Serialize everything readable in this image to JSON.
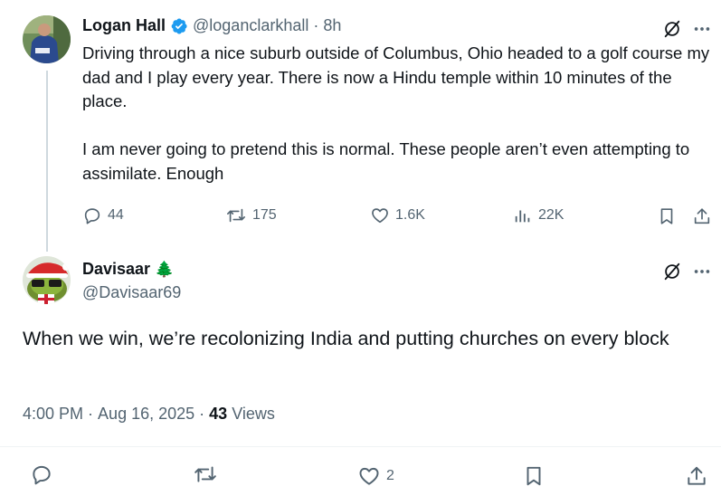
{
  "quoted_tweet": {
    "author_name": "Logan Hall",
    "handle": "@loganclarkhall",
    "separator": "·",
    "time_ago": "8h",
    "text": "Driving through a nice suburb outside of Columbus, Ohio headed to a golf course my dad and I play every year. There is now a Hindu temple within 10 minutes of the place.\n\nI am never going to pretend this is normal. These people aren’t even attempting to assimilate. Enough",
    "replies": "44",
    "reposts": "175",
    "likes": "1.6K",
    "views": "22K"
  },
  "reply_tweet": {
    "author_name": "Davisaar",
    "emoji": "🌲",
    "handle": "@Davisaar69",
    "text": "When we win, we’re recolonizing India and putting churches on every block",
    "time": "4:00 PM",
    "separator": "·",
    "date": "Aug 16, 2025",
    "separator2": "·",
    "views_count": "43",
    "views_label": "Views",
    "likes": "2"
  },
  "icons": {
    "grok": "grok-icon",
    "more": "more-icon",
    "verified": "verified-badge-icon",
    "reply": "reply-icon",
    "repost": "repost-icon",
    "like": "like-icon",
    "views": "views-icon",
    "bookmark": "bookmark-icon",
    "share": "share-icon"
  },
  "colors": {
    "verified": "#1d9bf0",
    "muted": "#536471",
    "text": "#0f1419",
    "thread_line": "#cfd9de"
  }
}
